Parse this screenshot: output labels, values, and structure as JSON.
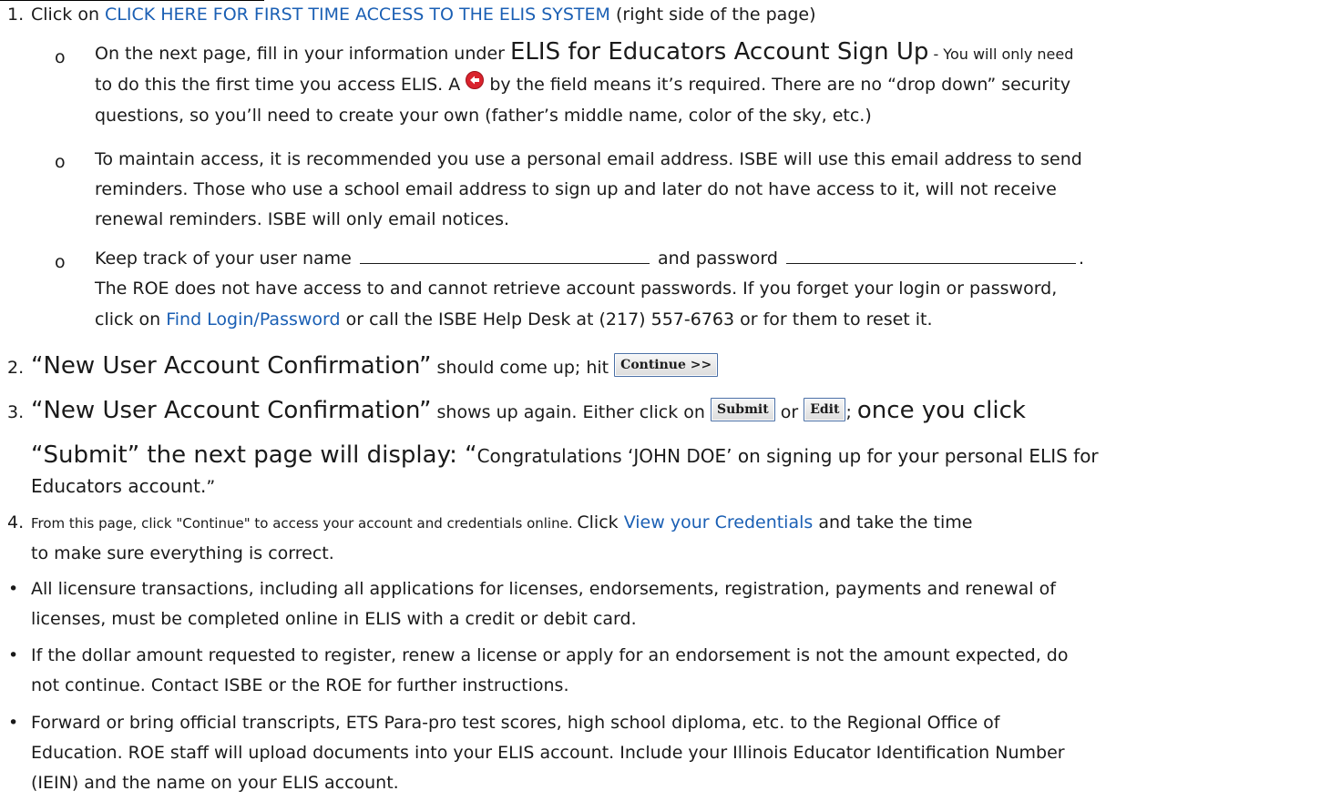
{
  "step1": {
    "number": "1.",
    "prefix": "Click on ",
    "link": "CLICK HERE FOR FIRST TIME ACCESS TO THE ELIS SYSTEM",
    "suffix": " (right side of the page)"
  },
  "sub1": {
    "marker": "o",
    "a": "On the next page, fill in your information under ",
    "heading": "ELIS for Educators Account Sign Up",
    "b": " - You will only need",
    "c": "to do this the first time you access ELIS.  A ",
    "d": " by the field means it’s required. There are no “drop down” security",
    "e": "questions, so you’ll need to create your own (father’s middle name, color of the sky, etc.)"
  },
  "sub2": {
    "marker": "o",
    "a": "To maintain access, it is recommended you use a personal email address. ISBE will use this email address to send",
    "b": "reminders. Those who use a school email address to sign up and later do not have access to it, will not receive",
    "c": "renewal reminders. ISBE will only email notices."
  },
  "sub3": {
    "marker": "o",
    "a": "Keep track of your user name ",
    "b": " and password ",
    "c": ".",
    "d": "The ROE does not have access to and cannot retrieve account passwords. If you forget your login or password,",
    "e": "click on ",
    "link": "Find Login/Password",
    "f": " or call the ISBE Help Desk at (217) 557-6763 or for them to reset it."
  },
  "step2": {
    "number": "2.",
    "heading": "“New User Account Confirmation”",
    "text": " should come up; hit ",
    "button": "Continue >>"
  },
  "step3": {
    "number": "3.",
    "heading": "“New User Account Confirmation”",
    "text": " shows up again. Either click on ",
    "submit": "Submit",
    "or": " or ",
    "edit": "Edit",
    "semi": "; ",
    "big_a": "once you click",
    "big_b": "“Submit” the next page will display: “",
    "congrats_a": "Congratulations ‘JOHN DOE’ on signing up for your personal ELIS for",
    "congrats_b": "Educators account.",
    "close": "”"
  },
  "step4": {
    "number": "4.",
    "a": "From this page, click \"Continue\" to access your account and credentials online. ",
    "b": "Click ",
    "link": "View your Credentials",
    "c": " and take the time",
    "d": "to make sure everything is correct."
  },
  "bullets": [
    {
      "line1": "All licensure transactions, including all applications for licenses, endorsements, registration, payments and renewal of",
      "line2": "licenses, must be completed online in ELIS with a credit or debit card."
    },
    {
      "line1": " If the dollar amount requested to register, renew a license or apply for an endorsement is not the amount expected, do",
      "line2": "not continue. Contact ISBE or the ROE for further instructions."
    },
    {
      "line1": "Forward or bring official transcripts, ETS Para-pro test scores, high school diploma, etc. to the Regional Office of",
      "line2": "Education. ROE staff will upload documents into your ELIS account. Include your Illinois Educator Identification Number",
      "line3": "(IEIN) and the name on your ELIS account."
    }
  ],
  "colors": {
    "link": "#1a5fb4",
    "required_icon": "#d9232d",
    "text": "#1a1a1a"
  },
  "icons": {
    "required": "arrow-left-circle-icon",
    "bullet": "bullet-dot"
  }
}
